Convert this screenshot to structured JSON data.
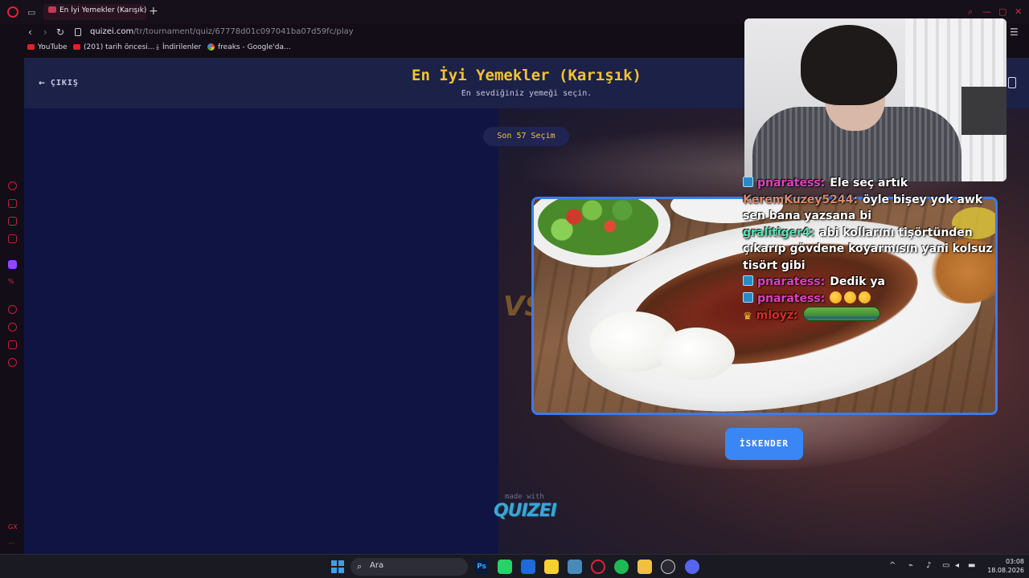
{
  "browser": {
    "tab_title": "En İyi Yemekler (Karışık) - I",
    "url_domain": "quizei.com",
    "url_path": "/tr/tournament/quiz/67778d01c097041ba07d59fc/play",
    "bookmarks": [
      {
        "label": "YouTube"
      },
      {
        "label": "(201) tarih öncesi..."
      },
      {
        "label": "İndirilenler"
      },
      {
        "label": "freaks - Google'da..."
      }
    ]
  },
  "page": {
    "exit_label": "ÇIKIŞ",
    "title": "En İyi Yemekler (Karışık)",
    "subtitle": "En sevdiğiniz yemeği seçin.",
    "round_label": "Son 57 Seçim",
    "vs_label": "VS",
    "choice_label": "İSKENDER",
    "made_with": "made with",
    "brand": "QUIZEI"
  },
  "sidebar": {
    "gx_label": "GX",
    "more_label": "..."
  },
  "chat": {
    "messages": [
      {
        "user": "pnaratess:",
        "user_color": "#e040c0",
        "badge": "blue",
        "text": "Ele seç artık"
      },
      {
        "user": "KeremKuzey5244:",
        "user_color": "#d88a6a",
        "badge": "",
        "text": "öyle bişey yok awk sen bana yazsana bi"
      },
      {
        "user": "gralitiger4:",
        "user_color": "#5ae0b0",
        "badge": "",
        "text": "abi kollarını tişörtünden çıkarıp gövdene koyarmısın yani kolsuz tisört gibi"
      },
      {
        "user": "pnaratess:",
        "user_color": "#e040c0",
        "badge": "blue",
        "text": "Dedik ya"
      },
      {
        "user": "pnaratess:",
        "user_color": "#e040c0",
        "badge": "blue",
        "text": ""
      },
      {
        "user": "mloyz:",
        "user_color": "#e02a2a",
        "badge": "crown",
        "text": ""
      }
    ],
    "crown_glyph": "♛"
  },
  "taskbar": {
    "search_placeholder": "Ara",
    "ps_label": "Ps",
    "time": "03:08",
    "date": "18.08.2026"
  },
  "colors": {
    "accent_yellow": "#f4c430",
    "accent_blue": "#3b86f5",
    "page_bg": "#12153d",
    "opera_red": "#e0203a"
  }
}
